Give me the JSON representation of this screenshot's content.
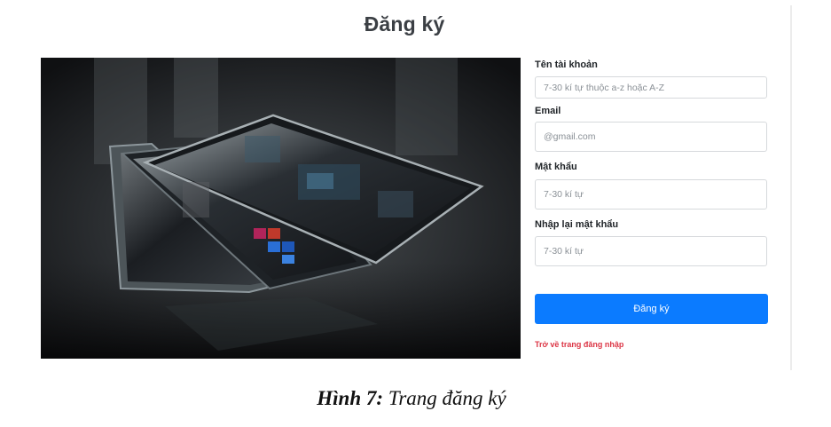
{
  "page": {
    "title": "Đăng ký"
  },
  "form": {
    "username": {
      "label": "Tên tài khoản",
      "placeholder": "7-30 kí tự thuộc a-z hoặc A-Z"
    },
    "email": {
      "label": "Email",
      "placeholder": "@gmail.com"
    },
    "password": {
      "label": "Mật khẩu",
      "placeholder": "7-30 kí tự"
    },
    "confirm_password": {
      "label": "Nhập lại mật khẩu",
      "placeholder": "7-30 kí tự"
    },
    "submit_label": "Đăng ký",
    "back_link": "Trở về trang đăng nhập"
  },
  "caption": {
    "prefix": "Hình 7:",
    "text": " Trang đăng ký"
  },
  "colors": {
    "primary_button": "#0b7bff",
    "link_red": "#dc3545",
    "title_text": "#3b3f44"
  }
}
